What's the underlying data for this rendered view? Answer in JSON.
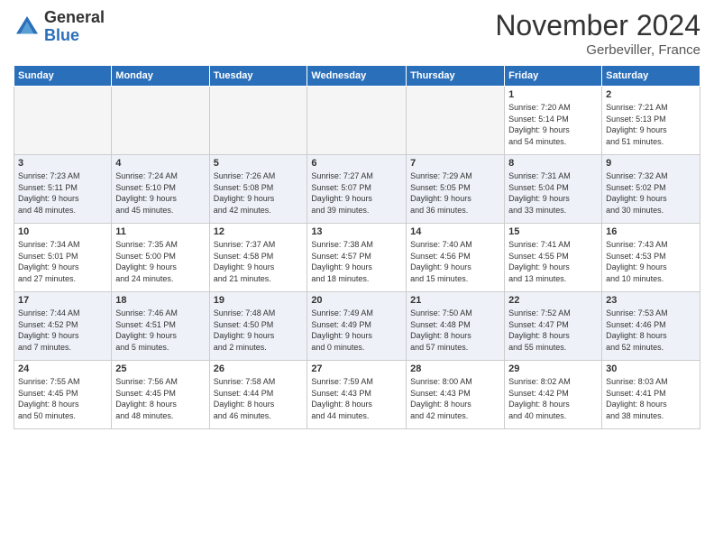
{
  "logo": {
    "general": "General",
    "blue": "Blue"
  },
  "title": "November 2024",
  "location": "Gerbeviller, France",
  "days": [
    "Sunday",
    "Monday",
    "Tuesday",
    "Wednesday",
    "Thursday",
    "Friday",
    "Saturday"
  ],
  "weeks": [
    [
      {
        "num": "",
        "info": ""
      },
      {
        "num": "",
        "info": ""
      },
      {
        "num": "",
        "info": ""
      },
      {
        "num": "",
        "info": ""
      },
      {
        "num": "",
        "info": ""
      },
      {
        "num": "1",
        "info": "Sunrise: 7:20 AM\nSunset: 5:14 PM\nDaylight: 9 hours\nand 54 minutes."
      },
      {
        "num": "2",
        "info": "Sunrise: 7:21 AM\nSunset: 5:13 PM\nDaylight: 9 hours\nand 51 minutes."
      }
    ],
    [
      {
        "num": "3",
        "info": "Sunrise: 7:23 AM\nSunset: 5:11 PM\nDaylight: 9 hours\nand 48 minutes."
      },
      {
        "num": "4",
        "info": "Sunrise: 7:24 AM\nSunset: 5:10 PM\nDaylight: 9 hours\nand 45 minutes."
      },
      {
        "num": "5",
        "info": "Sunrise: 7:26 AM\nSunset: 5:08 PM\nDaylight: 9 hours\nand 42 minutes."
      },
      {
        "num": "6",
        "info": "Sunrise: 7:27 AM\nSunset: 5:07 PM\nDaylight: 9 hours\nand 39 minutes."
      },
      {
        "num": "7",
        "info": "Sunrise: 7:29 AM\nSunset: 5:05 PM\nDaylight: 9 hours\nand 36 minutes."
      },
      {
        "num": "8",
        "info": "Sunrise: 7:31 AM\nSunset: 5:04 PM\nDaylight: 9 hours\nand 33 minutes."
      },
      {
        "num": "9",
        "info": "Sunrise: 7:32 AM\nSunset: 5:02 PM\nDaylight: 9 hours\nand 30 minutes."
      }
    ],
    [
      {
        "num": "10",
        "info": "Sunrise: 7:34 AM\nSunset: 5:01 PM\nDaylight: 9 hours\nand 27 minutes."
      },
      {
        "num": "11",
        "info": "Sunrise: 7:35 AM\nSunset: 5:00 PM\nDaylight: 9 hours\nand 24 minutes."
      },
      {
        "num": "12",
        "info": "Sunrise: 7:37 AM\nSunset: 4:58 PM\nDaylight: 9 hours\nand 21 minutes."
      },
      {
        "num": "13",
        "info": "Sunrise: 7:38 AM\nSunset: 4:57 PM\nDaylight: 9 hours\nand 18 minutes."
      },
      {
        "num": "14",
        "info": "Sunrise: 7:40 AM\nSunset: 4:56 PM\nDaylight: 9 hours\nand 15 minutes."
      },
      {
        "num": "15",
        "info": "Sunrise: 7:41 AM\nSunset: 4:55 PM\nDaylight: 9 hours\nand 13 minutes."
      },
      {
        "num": "16",
        "info": "Sunrise: 7:43 AM\nSunset: 4:53 PM\nDaylight: 9 hours\nand 10 minutes."
      }
    ],
    [
      {
        "num": "17",
        "info": "Sunrise: 7:44 AM\nSunset: 4:52 PM\nDaylight: 9 hours\nand 7 minutes."
      },
      {
        "num": "18",
        "info": "Sunrise: 7:46 AM\nSunset: 4:51 PM\nDaylight: 9 hours\nand 5 minutes."
      },
      {
        "num": "19",
        "info": "Sunrise: 7:48 AM\nSunset: 4:50 PM\nDaylight: 9 hours\nand 2 minutes."
      },
      {
        "num": "20",
        "info": "Sunrise: 7:49 AM\nSunset: 4:49 PM\nDaylight: 9 hours\nand 0 minutes."
      },
      {
        "num": "21",
        "info": "Sunrise: 7:50 AM\nSunset: 4:48 PM\nDaylight: 8 hours\nand 57 minutes."
      },
      {
        "num": "22",
        "info": "Sunrise: 7:52 AM\nSunset: 4:47 PM\nDaylight: 8 hours\nand 55 minutes."
      },
      {
        "num": "23",
        "info": "Sunrise: 7:53 AM\nSunset: 4:46 PM\nDaylight: 8 hours\nand 52 minutes."
      }
    ],
    [
      {
        "num": "24",
        "info": "Sunrise: 7:55 AM\nSunset: 4:45 PM\nDaylight: 8 hours\nand 50 minutes."
      },
      {
        "num": "25",
        "info": "Sunrise: 7:56 AM\nSunset: 4:45 PM\nDaylight: 8 hours\nand 48 minutes."
      },
      {
        "num": "26",
        "info": "Sunrise: 7:58 AM\nSunset: 4:44 PM\nDaylight: 8 hours\nand 46 minutes."
      },
      {
        "num": "27",
        "info": "Sunrise: 7:59 AM\nSunset: 4:43 PM\nDaylight: 8 hours\nand 44 minutes."
      },
      {
        "num": "28",
        "info": "Sunrise: 8:00 AM\nSunset: 4:43 PM\nDaylight: 8 hours\nand 42 minutes."
      },
      {
        "num": "29",
        "info": "Sunrise: 8:02 AM\nSunset: 4:42 PM\nDaylight: 8 hours\nand 40 minutes."
      },
      {
        "num": "30",
        "info": "Sunrise: 8:03 AM\nSunset: 4:41 PM\nDaylight: 8 hours\nand 38 minutes."
      }
    ]
  ]
}
